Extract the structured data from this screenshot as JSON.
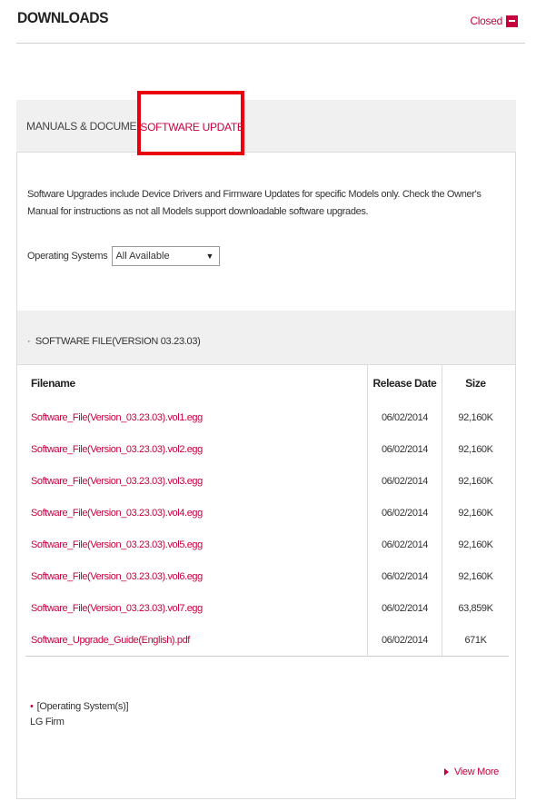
{
  "header": {
    "title": "DOWNLOADS",
    "closed_label": "Closed"
  },
  "tabs": [
    {
      "label": "MANUALS & DOCUMENTS",
      "active": false
    },
    {
      "label": "SOFTWARE UPDATE",
      "active": true
    }
  ],
  "description": "Software Upgrades include Device Drivers and Firmware Updates for specific Models only. Check the Owner's Manual for instructions as not all Models support downloadable software upgrades.",
  "os_filter": {
    "label": "Operating Systems",
    "selected": "All Available"
  },
  "file_section": {
    "title": "SOFTWARE FILE(VERSION 03.23.03)"
  },
  "table": {
    "headers": {
      "filename": "Filename",
      "release_date": "Release Date",
      "size": "Size"
    },
    "rows": [
      {
        "filename": "Software_File(Version_03.23.03).vol1.egg",
        "date": "06/02/2014",
        "size": "92,160K"
      },
      {
        "filename": "Software_File(Version_03.23.03).vol2.egg",
        "date": "06/02/2014",
        "size": "92,160K"
      },
      {
        "filename": "Software_File(Version_03.23.03).vol3.egg",
        "date": "06/02/2014",
        "size": "92,160K"
      },
      {
        "filename": "Software_File(Version_03.23.03).vol4.egg",
        "date": "06/02/2014",
        "size": "92,160K"
      },
      {
        "filename": "Software_File(Version_03.23.03).vol5.egg",
        "date": "06/02/2014",
        "size": "92,160K"
      },
      {
        "filename": "Software_File(Version_03.23.03).vol6.egg",
        "date": "06/02/2014",
        "size": "92,160K"
      },
      {
        "filename": "Software_File(Version_03.23.03).vol7.egg",
        "date": "06/02/2014",
        "size": "63,859K"
      },
      {
        "filename": "Software_Upgrade_Guide(English).pdf",
        "date": "06/02/2014",
        "size": "671K"
      }
    ]
  },
  "os_info": {
    "heading": "[Operating System(s)]",
    "value": "LG Firm"
  },
  "view_more_label": "View More",
  "colors": {
    "accent": "#c6003c",
    "highlight": "#e8000f"
  }
}
